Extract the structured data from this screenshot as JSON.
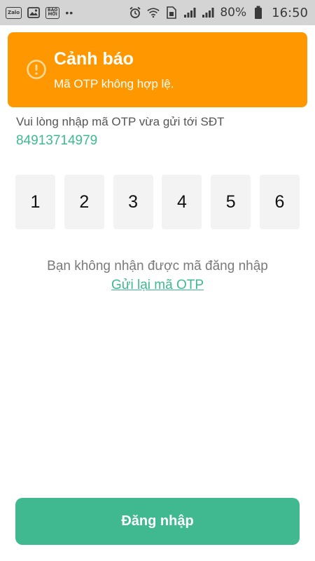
{
  "status_bar": {
    "apps": [
      "Zalo",
      "BÁO MỚI"
    ],
    "battery_percent": "80%",
    "time": "16:50",
    "icons": [
      "zalo-icon",
      "gallery-icon",
      "baomoi-icon",
      "more-dots-icon",
      "alarm-icon",
      "wifi-icon",
      "signal-icon",
      "battery-icon"
    ]
  },
  "warning": {
    "title": "Cảnh báo",
    "message": "Mã OTP không hợp lệ.",
    "color": "#ff9800"
  },
  "prompt": "Vui lòng nhập mã OTP vừa gửi tới SĐT",
  "phone": "84913714979",
  "otp_digits": [
    "1",
    "2",
    "3",
    "4",
    "5",
    "6"
  ],
  "no_code_text": "Bạn không nhận được mã đăng nhập",
  "resend_link": "Gửi lại mã OTP",
  "login_button": "Đăng nhập",
  "colors": {
    "accent": "#40b990",
    "warning": "#ff9800"
  }
}
